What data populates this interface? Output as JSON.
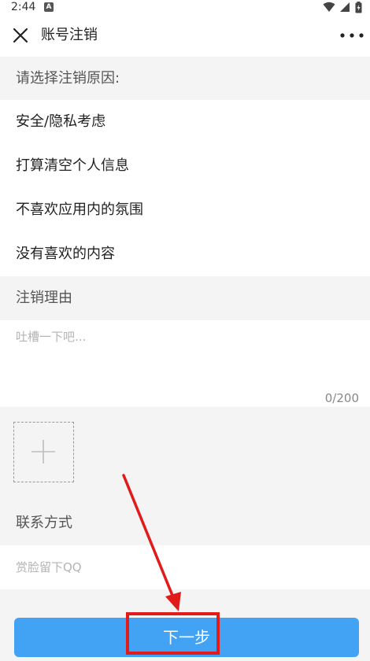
{
  "status_bar": {
    "time": "2:44",
    "app_badge": "A"
  },
  "header": {
    "title": "账号注销",
    "close_icon": "close-icon",
    "more_icon": "more-horizontal-icon"
  },
  "reason_section": {
    "label": "请选择注销原因:",
    "items": [
      {
        "label": "安全/隐私考虑"
      },
      {
        "label": "打算清空个人信息"
      },
      {
        "label": "不喜欢应用内的氛围"
      },
      {
        "label": "没有喜欢的内容"
      }
    ]
  },
  "detail_section": {
    "label": "注销理由",
    "placeholder": "吐槽一下吧...",
    "counter": "0/200"
  },
  "photo": {
    "add_icon": "plus-icon"
  },
  "contact_section": {
    "label": "联系方式",
    "placeholder": "赏脸留下QQ"
  },
  "next_button": {
    "label": "下一步"
  },
  "colors": {
    "accent": "#42a3f5",
    "annotation": "#e11a1a",
    "background": "#f4f4f4"
  }
}
